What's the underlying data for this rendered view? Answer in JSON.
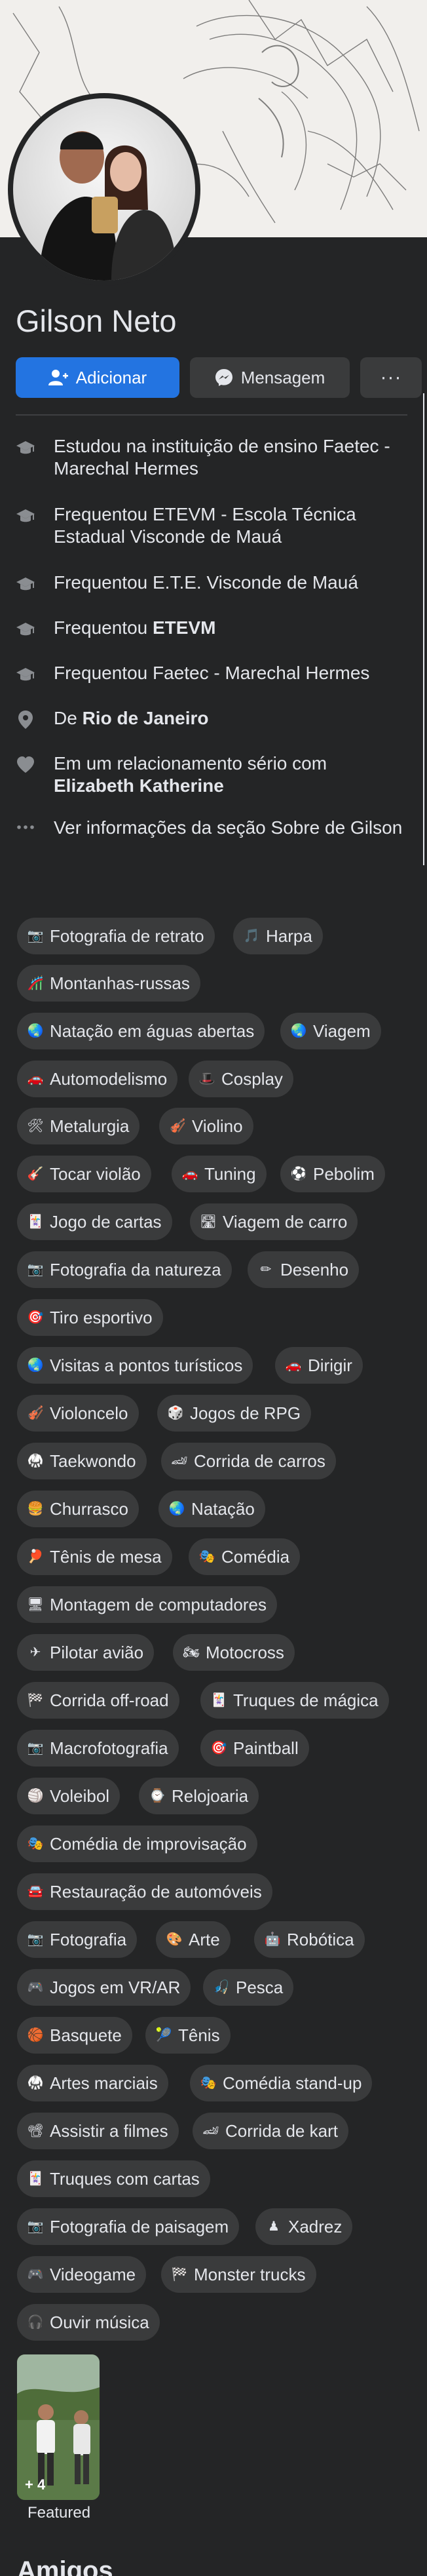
{
  "profile": {
    "name": "Gilson Neto",
    "add_label": "Adicionar",
    "message_label": "Mensagem",
    "more_label": "···"
  },
  "intro": [
    {
      "icon": "graduation-cap-icon",
      "pre": "Estudou na instituição de ensino Faetec - Marechal Hermes",
      "bold": "",
      "post": ""
    },
    {
      "icon": "graduation-cap-icon",
      "pre": "Frequentou ETEVM - Escola Técnica Estadual Visconde de Mauá",
      "bold": "",
      "post": ""
    },
    {
      "icon": "graduation-cap-icon",
      "pre": "Frequentou E.T.E. Visconde de Mauá",
      "bold": "",
      "post": ""
    },
    {
      "icon": "graduation-cap-icon",
      "pre": "Frequentou ",
      "bold": "ETEVM",
      "post": ""
    },
    {
      "icon": "graduation-cap-icon",
      "pre": "Frequentou Faetec - Marechal Hermes",
      "bold": "",
      "post": ""
    },
    {
      "icon": "location-pin-icon",
      "pre": "De ",
      "bold": "Rio de Janeiro",
      "post": ""
    },
    {
      "icon": "heart-icon",
      "pre": "Em um relacionamento sério com ",
      "bold": "Elizabeth Katherine",
      "post": ""
    },
    {
      "icon": "more-dots-icon",
      "pre": "Ver informações da seção Sobre de Gilson",
      "bold": "",
      "post": ""
    }
  ],
  "hobbies": [
    {
      "label": "Fotografia de retrato",
      "icon": "camera-icon"
    },
    {
      "label": "Harpa",
      "icon": "harp-icon"
    },
    {
      "label": "Montanhas-russas",
      "icon": "roller-coaster-icon"
    },
    {
      "label": "Natação em águas abertas",
      "icon": "globe-icon"
    },
    {
      "label": "Viagem",
      "icon": "globe-icon"
    },
    {
      "label": "Automodelismo",
      "icon": "car-icon"
    },
    {
      "label": "Cosplay",
      "icon": "top-hat-icon"
    },
    {
      "label": "Metalurgia",
      "icon": "tools-icon"
    },
    {
      "label": "Violino",
      "icon": "violin-icon"
    },
    {
      "label": "Tocar violão",
      "icon": "guitar-icon"
    },
    {
      "label": "Tuning",
      "icon": "car-icon"
    },
    {
      "label": "Pebolim",
      "icon": "soccer-ball-icon"
    },
    {
      "label": "Jogo de cartas",
      "icon": "playing-card-icon"
    },
    {
      "label": "Viagem de carro",
      "icon": "road-icon"
    },
    {
      "label": "Fotografia da natureza",
      "icon": "camera-icon"
    },
    {
      "label": "Desenho",
      "icon": "pencil-icon"
    },
    {
      "label": "Tiro esportivo",
      "icon": "target-icon"
    },
    {
      "label": "Visitas a pontos turísticos",
      "icon": "globe-icon"
    },
    {
      "label": "Dirigir",
      "icon": "car-icon"
    },
    {
      "label": "Violoncelo",
      "icon": "cello-icon"
    },
    {
      "label": "Jogos de RPG",
      "icon": "dice-icon"
    },
    {
      "label": "Taekwondo",
      "icon": "martial-arts-icon"
    },
    {
      "label": "Corrida de carros",
      "icon": "race-car-icon"
    },
    {
      "label": "Churrasco",
      "icon": "burger-icon"
    },
    {
      "label": "Natação",
      "icon": "globe-icon"
    },
    {
      "label": "Tênis de mesa",
      "icon": "ping-pong-icon"
    },
    {
      "label": "Comédia",
      "icon": "theater-masks-icon"
    },
    {
      "label": "Montagem de computadores",
      "icon": "computer-icon"
    },
    {
      "label": "Pilotar avião",
      "icon": "airplane-icon"
    },
    {
      "label": "Motocross",
      "icon": "motorcycle-icon"
    },
    {
      "label": "Corrida off-road",
      "icon": "checkered-flag-icon"
    },
    {
      "label": "Truques de mágica",
      "icon": "playing-card-icon"
    },
    {
      "label": "Macrofotografia",
      "icon": "camera-icon"
    },
    {
      "label": "Paintball",
      "icon": "target-icon"
    },
    {
      "label": "Voleibol",
      "icon": "volleyball-icon"
    },
    {
      "label": "Relojoaria",
      "icon": "watch-icon"
    },
    {
      "label": "Comédia de improvisação",
      "icon": "theater-masks-icon"
    },
    {
      "label": "Restauração de automóveis",
      "icon": "car-icon"
    },
    {
      "label": "Fotografia",
      "icon": "camera-icon"
    },
    {
      "label": "Arte",
      "icon": "palette-icon"
    },
    {
      "label": "Robótica",
      "icon": "robot-icon"
    },
    {
      "label": "Jogos em VR/AR",
      "icon": "gamepad-icon"
    },
    {
      "label": "Pesca",
      "icon": "fishing-rod-icon"
    },
    {
      "label": "Basquete",
      "icon": "basketball-icon"
    },
    {
      "label": "Tênis",
      "icon": "tennis-racket-icon"
    },
    {
      "label": "Artes marciais",
      "icon": "martial-arts-icon"
    },
    {
      "label": "Comédia stand-up",
      "icon": "theater-masks-icon"
    },
    {
      "label": "Assistir a filmes",
      "icon": "film-projector-icon"
    },
    {
      "label": "Corrida de kart",
      "icon": "race-car-icon"
    },
    {
      "label": "Truques com cartas",
      "icon": "playing-card-icon"
    },
    {
      "label": "Fotografia de paisagem",
      "icon": "camera-icon"
    },
    {
      "label": "Xadrez",
      "icon": "chess-pawn-icon"
    },
    {
      "label": "Videogame",
      "icon": "gamepad-icon"
    },
    {
      "label": "Monster trucks",
      "icon": "checkered-flag-icon"
    },
    {
      "label": "Ouvir música",
      "icon": "headphones-icon"
    }
  ],
  "featured": {
    "count": "+ 4",
    "label": "Featured"
  },
  "next_section_title": "Amigos",
  "colors": {
    "background": "#242526",
    "chip": "#3a3b3c",
    "primary": "#2374e1",
    "text": "#e4e6eb"
  }
}
